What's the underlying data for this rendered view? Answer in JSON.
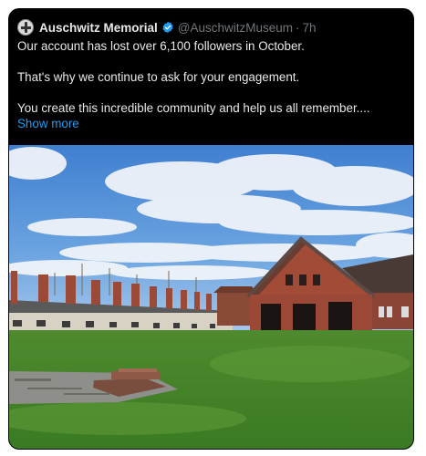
{
  "post": {
    "display_name": "Auschwitz Memorial",
    "handle": "@AuschwitzMuseum",
    "separator": "·",
    "time": "7h",
    "paragraphs": [
      "Our account has lost over 6,100 followers in October.",
      "That's why we continue to ask for your engagement.",
      "You create this incredible community and help us all remember...."
    ],
    "show_more": "Show more",
    "verified_icon": "verified-badge-icon",
    "accent_color": "#1d9bf0"
  },
  "media": {
    "type": "photo"
  }
}
